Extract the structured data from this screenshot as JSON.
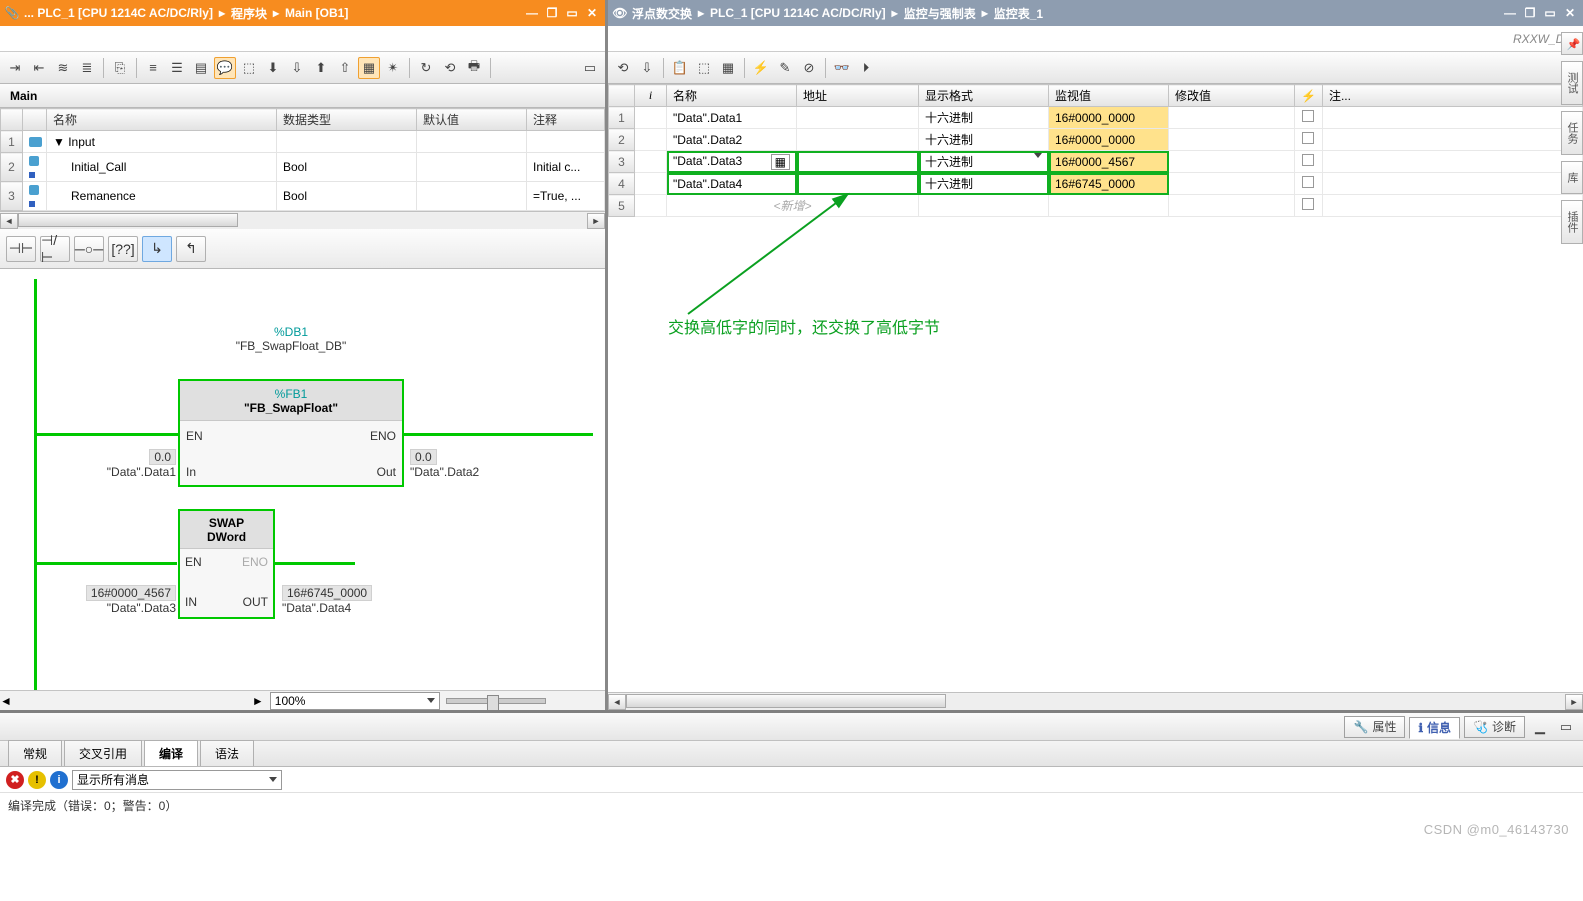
{
  "left": {
    "breadcrumb": [
      "... PLC_1 [CPU 1214C AC/DC/Rly]",
      "程序块",
      "Main [OB1]"
    ],
    "mainLabel": "Main",
    "iface": {
      "cols": [
        "名称",
        "数据类型",
        "默认值",
        "注释"
      ],
      "rows": [
        {
          "num": "1",
          "indent": 0,
          "icon": "sq",
          "name": "Input",
          "type": "",
          "def": "",
          "cmt": ""
        },
        {
          "num": "2",
          "indent": 1,
          "icon": "dot",
          "name": "Initial_Call",
          "type": "Bool",
          "def": "",
          "cmt": "Initial c..."
        },
        {
          "num": "3",
          "indent": 1,
          "icon": "dot",
          "name": "Remanence",
          "type": "Bool",
          "def": "",
          "cmt": "=True, ..."
        }
      ]
    },
    "ladder": {
      "db": "%DB1",
      "dbName": "\"FB_SwapFloat_DB\"",
      "fb1": {
        "inst": "%FB1",
        "name": "\"FB_SwapFloat\"",
        "en": "EN",
        "eno": "ENO",
        "pin_in": "In",
        "pin_out": "Out",
        "inVal": "0.0",
        "inVar": "\"Data\".Data1",
        "outVal": "0.0",
        "outVar": "\"Data\".Data2"
      },
      "fb2": {
        "name1": "SWAP",
        "name2": "DWord",
        "en": "EN",
        "eno": "ENO",
        "pin_in": "IN",
        "pin_out": "OUT",
        "inVal": "16#0000_4567",
        "inVar": "\"Data\".Data3",
        "outVal": "16#6745_0000",
        "outVar": "\"Data\".Data4"
      }
    },
    "zoom": "100%"
  },
  "right": {
    "breadcrumb": [
      "浮点数交换",
      "PLC_1 [CPU 1214C AC/DC/Rly]",
      "监控与强制表",
      "监控表_1"
    ],
    "brand": "RXXW_Dor",
    "watch": {
      "cols": {
        "i": "i",
        "name": "名称",
        "addr": "地址",
        "fmt": "显示格式",
        "mon": "监视值",
        "mod": "修改值",
        "bolt": "⚡",
        "cmt": "注..."
      },
      "rows": [
        {
          "num": "1",
          "name": "\"Data\".Data1",
          "addr": "",
          "fmt": "十六进制",
          "mon": "16#0000_0000",
          "hl": false
        },
        {
          "num": "2",
          "name": "\"Data\".Data2",
          "addr": "",
          "fmt": "十六进制",
          "mon": "16#0000_0000",
          "hl": false
        },
        {
          "num": "3",
          "name": "\"Data\".Data3",
          "addr": "",
          "fmt": "十六进制",
          "mon": "16#0000_4567",
          "hl": true,
          "sel": true
        },
        {
          "num": "4",
          "name": "\"Data\".Data4",
          "addr": "",
          "fmt": "十六进制",
          "mon": "16#6745_0000",
          "hl": true
        },
        {
          "num": "5",
          "add": "<新增>"
        }
      ]
    },
    "annotation": "交换高低字的同时，还交换了高低字节",
    "sidetabs": [
      "测试",
      "任务",
      "库",
      "插件"
    ]
  },
  "bottom": {
    "tabs": [
      {
        "icon": "🔧",
        "label": "属性"
      },
      {
        "icon": "ℹ",
        "label": "信息",
        "active": true
      },
      {
        "icon": "🩺",
        "label": "诊断"
      }
    ],
    "subtabs": [
      "常规",
      "交叉引用",
      "编译",
      "语法"
    ],
    "subActive": 2,
    "msgFilter": "显示所有消息",
    "status": "编译完成（错误：0；警告：0）",
    "watermark": "CSDN @m0_46143730"
  }
}
